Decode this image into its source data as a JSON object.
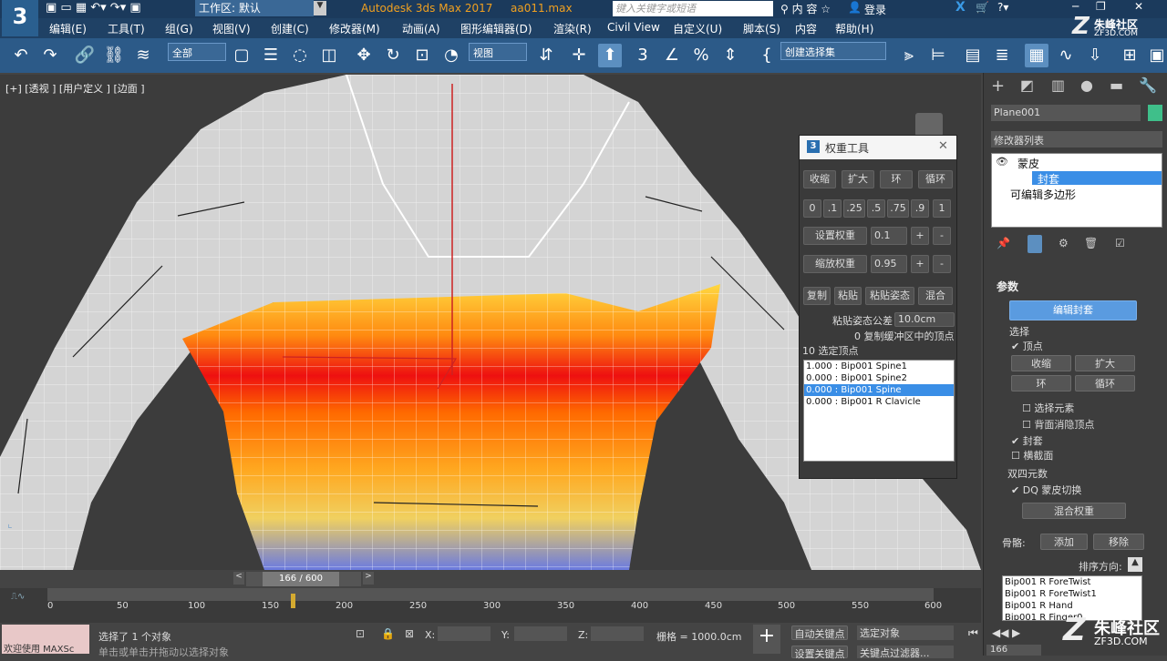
{
  "app": {
    "title": "Autodesk 3ds Max 2017",
    "file": "aa011.max",
    "workspace": "工作区: 默认",
    "search_placeholder": "键入关键字或短语",
    "login": "登录",
    "watermark_top": "朱峰社区",
    "watermark_top_sub": "ZF3D.COM",
    "watermark_bottom": "朱峰社区",
    "watermark_bottom_sub": "ZF3D.COM"
  },
  "menu": [
    "编辑(E)",
    "工具(T)",
    "组(G)",
    "视图(V)",
    "创建(C)",
    "修改器(M)",
    "动画(A)",
    "图形编辑器(D)",
    "渲染(R)",
    "Civil View",
    "自定义(U)",
    "脚本(S)",
    "内容",
    "帮助(H)"
  ],
  "toolbar": {
    "filter": "全部",
    "ref_coord": "视图",
    "selection_set": "创建选择集"
  },
  "viewport": {
    "label": "[+] [透视 ] [用户定义 ] [边面 ]"
  },
  "weight_tool": {
    "title": "权重工具",
    "row1": [
      "收缩",
      "扩大",
      "环",
      "循环"
    ],
    "presets": [
      "0",
      ".1",
      ".25",
      ".5",
      ".75",
      ".9",
      "1"
    ],
    "set_weight": "设置权重",
    "set_value": "0.1",
    "scale_weight": "缩放权重",
    "scale_value": "0.95",
    "row4": [
      "复制",
      "粘贴",
      "粘贴姿态",
      "混合"
    ],
    "paste_tol_label": "粘贴姿态公差",
    "paste_tol_value": "10.0cm",
    "buffer_text": "0 复制缓冲区中的顶点",
    "selected_count": "10 选定顶点",
    "list": [
      "1.000 : Bip001 Spine1",
      "0.000 : Bip001 Spine2",
      "0.000 : Bip001 Spine",
      "0.000 : Bip001 R Clavicle"
    ],
    "selected_index": 2
  },
  "cmdpanel": {
    "object_name": "Plane001",
    "object_color": "#3fbf8a",
    "modifier_list": "修改器列表",
    "stack": [
      "蒙皮",
      "封套",
      "可编辑多边形"
    ],
    "rollout": "参数",
    "edit_envelopes": "编辑封套",
    "select_group": "选择",
    "vertex": "顶点",
    "sel_buttons": [
      "收缩",
      "扩大",
      "环",
      "循环"
    ],
    "select_elem": "选择元素",
    "backface": "背面消隐顶点",
    "envelopes": "封套",
    "cross_sections": "横截面",
    "dq_group": "双四元数",
    "dq_toggle": "DQ 蒙皮切换",
    "blend_weights": "混合权重",
    "bones_label": "骨骼:",
    "add": "添加",
    "remove": "移除",
    "sort_label": "排序方向:",
    "bones": [
      "Bip001 R ForeTwist",
      "Bip001 R ForeTwist1",
      "Bip001 R Hand",
      "Bip001 R Finger0"
    ]
  },
  "timeline": {
    "frame_display": "166 / 600",
    "current_frame": 166,
    "total": 600,
    "ticks": [
      "0",
      "50",
      "100",
      "150",
      "200",
      "250",
      "300",
      "350",
      "400",
      "450",
      "500",
      "550",
      "600"
    ]
  },
  "status": {
    "selected": "选择了 1 个对象",
    "maxscript": "欢迎使用 MAXSc",
    "x_label": "X:",
    "y_label": "Y:",
    "z_label": "Z:",
    "grid": "栅格 = 1000.0cm",
    "auto_key": "自动关键点",
    "set_key": "设置关键点",
    "sel_object": "选定对象",
    "key_filters": "关键点过滤器...",
    "frame_field": "166",
    "hint": "单击或单击并拖动以选择对象"
  }
}
